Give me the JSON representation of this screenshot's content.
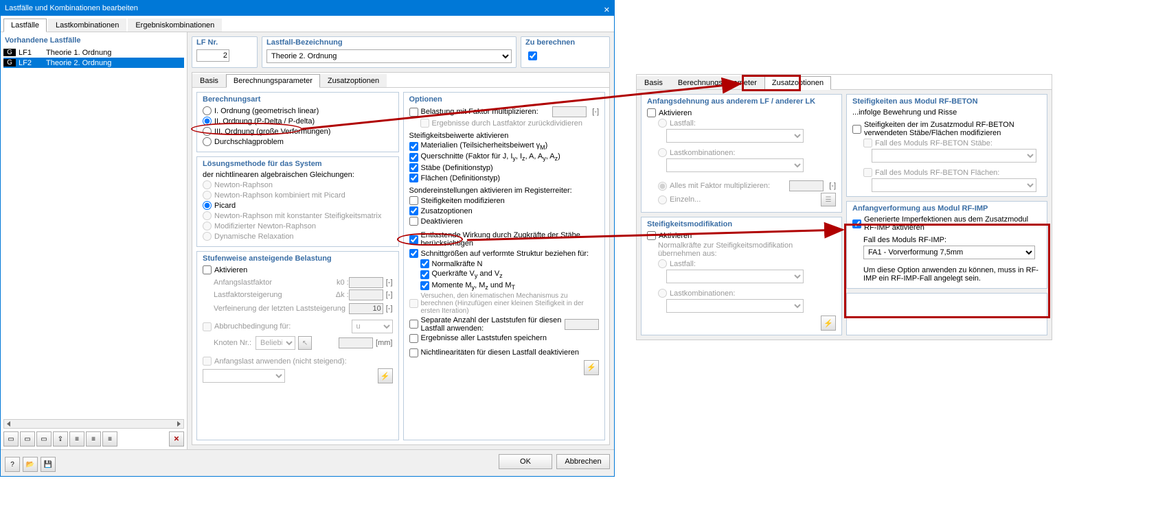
{
  "window": {
    "title": "Lastfälle und Kombinationen bearbeiten"
  },
  "mainTabs": {
    "t0": "Lastfälle",
    "t1": "Lastkombinationen",
    "t2": "Ergebniskombinationen"
  },
  "leftPanel": {
    "title": "Vorhandene Lastfälle",
    "rows": [
      {
        "tag": "G",
        "code": "LF1",
        "name": "Theorie 1. Ordnung"
      },
      {
        "tag": "G",
        "code": "LF2",
        "name": "Theorie 2. Ordnung"
      }
    ]
  },
  "topFields": {
    "lfNr": {
      "label": "LF Nr.",
      "value": "2"
    },
    "bezeichnung": {
      "label": "Lastfall-Bezeichnung",
      "value": "Theorie 2. Ordnung"
    },
    "zuBerechnen": {
      "label": "Zu berechnen"
    }
  },
  "subTabs": {
    "t0": "Basis",
    "t1": "Berechnungsparameter",
    "t2": "Zusatzoptionen"
  },
  "berechnungsart": {
    "title": "Berechnungsart",
    "o1": "I. Ordnung (geometrisch linear)",
    "o2": "II. Ordnung (P-Delta / P-delta)",
    "o3": "III. Ordnung (große Verformungen)",
    "o4": "Durchschlagproblem"
  },
  "loesung": {
    "title": "Lösungsmethode für das System",
    "sub": "der nichtlinearen algebraischen Gleichungen:",
    "nr": "Newton-Raphson",
    "nrp": "Newton-Raphson kombiniert mit Picard",
    "picard": "Picard",
    "nrks": "Newton-Raphson mit konstanter Steifigkeitsmatrix",
    "mnr": "Modifizierter Newton-Raphson",
    "dr": "Dynamische Relaxation"
  },
  "stufen": {
    "title": "Stufenweise ansteigende Belastung",
    "aktivieren": "Aktivieren",
    "anfangsfaktor": "Anfangslastfaktor",
    "k0": "k0 :",
    "lastfaktor": "Lastfaktorsteigerung",
    "dk": "Δk :",
    "verfeinerung": "Verfeinerung der letzten Laststeigerung",
    "verfVal": "10",
    "abbruch": "Abbruchbedingung für:",
    "abbruchVal": "u",
    "knoten": "Knoten Nr.:",
    "knotenVal": "Beliebig",
    "mm": "[mm]",
    "anfangslast": "Anfangslast anwenden (nicht steigend):"
  },
  "optionen": {
    "title": "Optionen",
    "belastung": "Belastung mit Faktor multiplizieren:",
    "ergebnisse": "Ergebnisse durch Lastfaktor zurückdividieren",
    "steifHeader": "Steifigkeitsbeiwerte aktivieren",
    "materialien": "Materialien (Teilsicherheitsbeiwert γM)",
    "querschnitte": "Querschnitte (Faktor für J, Iy, Iz, A, Ay, Az)",
    "staebe": "Stäbe (Definitionstyp)",
    "flaechen": "Flächen (Definitionstyp)",
    "sonderHeader": "Sondereinstellungen aktivieren im Registerreiter:",
    "steifMod": "Steifigkeiten modifizieren",
    "zusatz": "Zusatzoptionen",
    "deaktivieren": "Deaktivieren",
    "entlastende": "Entlastende Wirkung durch Zugkräfte der Stäbe berücksichtigen",
    "schnitt": "Schnittgrößen auf verformte Struktur beziehen für:",
    "normal": "Normalkräfte N",
    "quer": "Querkräfte Vy and Vz",
    "momente": "Momente My, Mz und MT",
    "versuchen": "Versuchen, den kinematischen Mechanismus zu berechnen (Hinzufügen einer kleinen Steifigkeit in der ersten Iteration)",
    "separate": "Separate Anzahl der Laststufen für diesen Lastfall anwenden:",
    "ergebnisseAll": "Ergebnisse aller Laststufen speichern",
    "nichtlin": "Nichtlinearitäten für diesen Lastfall deaktivieren"
  },
  "buttons": {
    "ok": "OK",
    "cancel": "Abbrechen"
  },
  "rightWin": {
    "anfDehn": {
      "title": "Anfangsdehnung aus anderem LF / anderer LK",
      "aktivieren": "Aktivieren",
      "lastfall": "Lastfall:",
      "lastkomb": "Lastkombinationen:",
      "alles": "Alles mit Faktor multiplizieren:",
      "einzeln": "Einzeln..."
    },
    "steifMod": {
      "title": "Steifigkeitsmodifikation",
      "aktivieren": "Aktivieren",
      "normal": "Normalkräfte zur Steifigkeitsmodifikation übernehmen aus:",
      "lastfall": "Lastfall:",
      "lastkomb": "Lastkombinationen:"
    },
    "steifBeton": {
      "title": "Steifigkeiten aus Modul RF-BETON",
      "sub": "...infolge Bewehrung und Risse",
      "opt": "Steifigkeiten der im Zusatzmodul RF-BETON verwendeten Stäbe/Flächen modifizieren",
      "staebe": "Fall des Moduls RF-BETON Stäbe:",
      "flaechen": "Fall des Moduls RF-BETON Flächen:"
    },
    "anfVerf": {
      "title": "Anfangverformung aus Modul RF-IMP",
      "gen": "Generierte Imperfektionen aus dem Zusatzmodul RF-IMP aktivieren",
      "fall": "Fall des Moduls RF-IMP:",
      "value": "FA1 - Vorverformung 7,5mm",
      "note": "Um diese Option anwenden zu können, muss in RF-IMP ein RF-IMP-Fall angelegt sein."
    }
  }
}
